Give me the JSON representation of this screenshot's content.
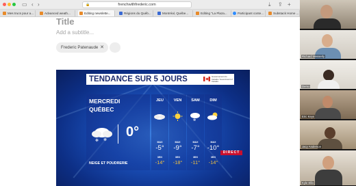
{
  "browser": {
    "url": "frenchwithfrederic.com",
    "tabs": [
      {
        "label": "Mes trucs pour a..."
      },
      {
        "label": "Advanced weath..."
      },
      {
        "label": "Editing newslette..."
      },
      {
        "label": "Régions du Québ..."
      },
      {
        "label": "Montréal, Québe..."
      },
      {
        "label": "Editing \"La Plaza..."
      },
      {
        "label": "Participant conte..."
      },
      {
        "label": "Substack Home ..."
      }
    ]
  },
  "editor": {
    "title": "Title",
    "subtitle_placeholder": "Add a subtitle...",
    "author": "Frederic Patenaude"
  },
  "weather": {
    "banner_title": "TENDANCE SUR 5 JOURS",
    "gov_text": "Gouvernement du Canada / Government of Canada",
    "today": {
      "day": "MERCREDI",
      "city": "QUÉBEC",
      "temp": "0°",
      "condition": "NEIGE ET POUDRERIE",
      "icon": "cloud-snow-icon"
    },
    "max_label": "MAX",
    "min_label": "MIN",
    "days": [
      {
        "name": "JEU",
        "max": "-5°",
        "min": "-14°",
        "icon": "cloud-icon"
      },
      {
        "name": "VEN",
        "max": "-9°",
        "min": "-18°",
        "icon": "sun-icon"
      },
      {
        "name": "SAM",
        "max": "-7°",
        "min": "-11°",
        "icon": "cloud-snow-icon"
      },
      {
        "name": "DIM",
        "max": "-10°",
        "min": "-14°",
        "icon": "sun-cloud-icon"
      }
    ],
    "live_label": "DIRECT"
  },
  "participants": [
    {
      "name": ""
    },
    {
      "name": "Richard Messerly"
    },
    {
      "name": "Demo"
    },
    {
      "name": "Eric Keys"
    },
    {
      "name": "Jacy Anderson"
    },
    {
      "name": "Kyle Ellis"
    }
  ],
  "colors": {
    "banner_text": "#1b2a6e",
    "min_temp": "#f0c040",
    "live_red": "#c8102e",
    "weather_bg": "#1a4fb8"
  }
}
